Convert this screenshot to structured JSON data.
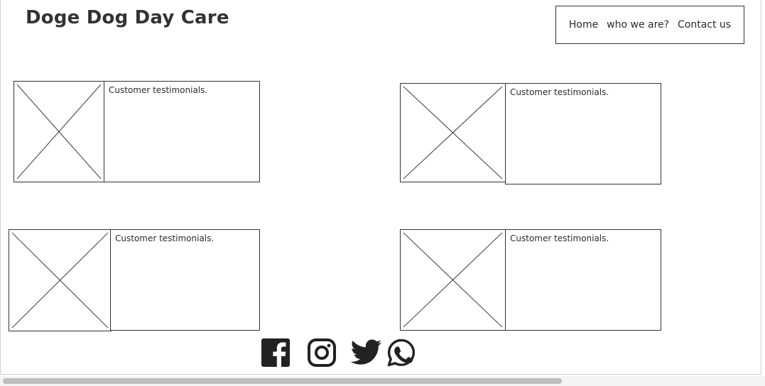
{
  "header": {
    "site_title": "Doge Dog Day Care"
  },
  "nav": {
    "items": [
      {
        "label": "Home"
      },
      {
        "label": "who we are?"
      },
      {
        "label": "Contact us"
      }
    ]
  },
  "testimonials": [
    {
      "text": "Customer testimonials."
    },
    {
      "text": "Customer testimonials."
    },
    {
      "text": "Customer testimonials."
    },
    {
      "text": "Customer testimonials."
    }
  ],
  "social": {
    "icons": [
      "facebook-icon",
      "instagram-icon",
      "twitter-icon",
      "whatsapp-icon"
    ],
    "icon_color": "#222222"
  }
}
